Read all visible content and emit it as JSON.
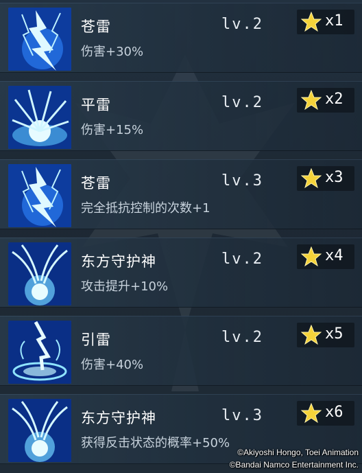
{
  "skills": [
    {
      "name": "苍雷",
      "desc": "伤害+30%",
      "level": "lv.2",
      "count": "x1",
      "icon": "lightning-strike-icon"
    },
    {
      "name": "平雷",
      "desc": "伤害+15%",
      "level": "lv.2",
      "count": "x2",
      "icon": "lightning-burst-icon"
    },
    {
      "name": "苍雷",
      "desc": "完全抵抗控制的次数+1",
      "level": "lv.3",
      "count": "x3",
      "icon": "lightning-strike-icon"
    },
    {
      "name": "东方守护神",
      "desc": "攻击提升+10%",
      "level": "lv.2",
      "count": "x4",
      "icon": "guardian-dragon-icon"
    },
    {
      "name": "引雷",
      "desc": "伤害+40%",
      "level": "lv.2",
      "count": "x5",
      "icon": "lightning-vortex-icon"
    },
    {
      "name": "东方守护神",
      "desc": "获得反击状态的概率+50%",
      "level": "lv.3",
      "count": "x6",
      "icon": "guardian-dragon-icon"
    }
  ],
  "copyright": {
    "line1": "©Akiyoshi Hongo, Toei Animation",
    "line2": "©Bandai Namco Entertainment Inc."
  },
  "colors": {
    "background": "#1e2a35",
    "star": "#f5d33a",
    "icon_glow": "#4fb4ff"
  }
}
